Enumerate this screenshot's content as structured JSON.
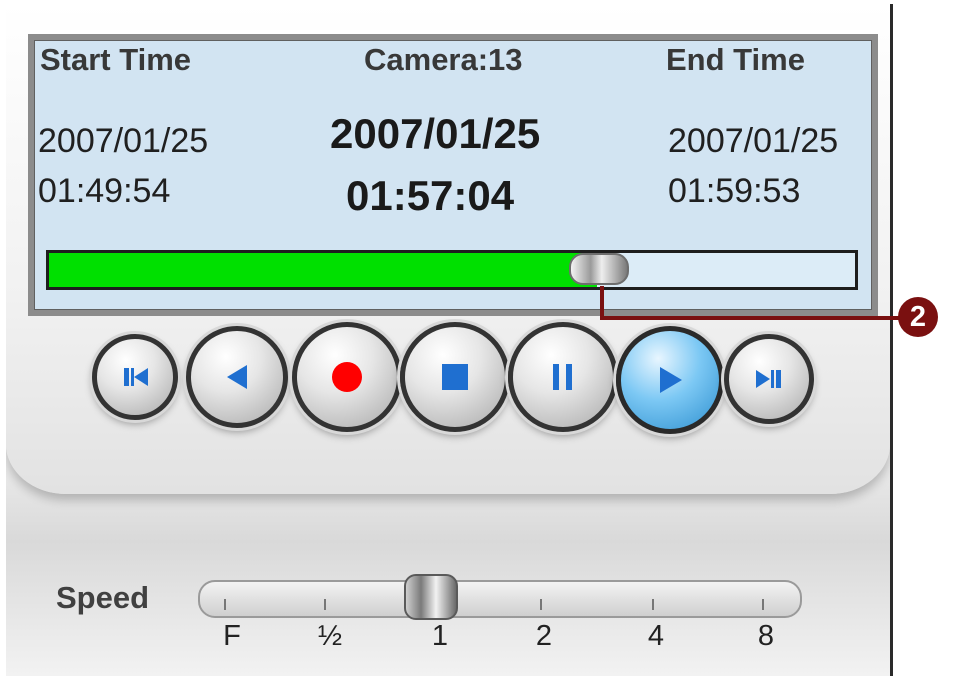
{
  "display": {
    "start_label": "Start Time",
    "camera_label": "Camera:13",
    "end_label": "End Time",
    "start_date": "2007/01/25",
    "start_time": "01:49:54",
    "current_date": "2007/01/25",
    "current_time": "01:57:04",
    "end_date": "2007/01/25",
    "end_time": "01:59:53"
  },
  "progress": {
    "fraction": 0.68,
    "fill_color": "#00e000"
  },
  "callout": {
    "number": "2",
    "color": "#7a1010"
  },
  "controls": [
    {
      "name": "skip-to-start",
      "icon": "skip-back-icon"
    },
    {
      "name": "rewind",
      "icon": "reverse-play-icon"
    },
    {
      "name": "record",
      "icon": "record-icon"
    },
    {
      "name": "stop",
      "icon": "stop-icon"
    },
    {
      "name": "pause",
      "icon": "pause-icon"
    },
    {
      "name": "play",
      "icon": "play-icon",
      "active": true
    },
    {
      "name": "skip-to-end",
      "icon": "skip-forward-icon"
    }
  ],
  "speed": {
    "label": "Speed",
    "options": [
      "F",
      "½",
      "1",
      "2",
      "4",
      "8"
    ],
    "selected": "1"
  },
  "colors": {
    "record": "#ff0000",
    "icon_blue": "#1f6fd0",
    "display_bg": "#d2e4f2"
  }
}
